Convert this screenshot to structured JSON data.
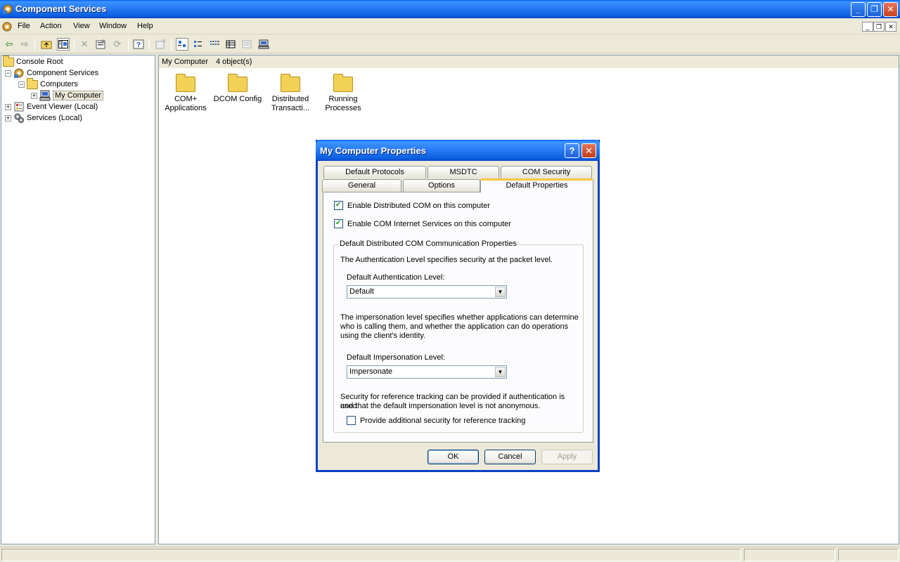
{
  "window": {
    "title": "Component Services",
    "controls": {
      "minimize": "_",
      "maximize": "❐",
      "close": "✕"
    }
  },
  "menubar": {
    "items": [
      "File",
      "Action",
      "View",
      "Window",
      "Help"
    ]
  },
  "toolbar": {
    "icons": [
      "back-icon",
      "forward-icon",
      "up-folder-icon",
      "show-hide-tree-icon",
      "delete-icon",
      "properties-icon",
      "refresh-icon",
      "help-icon",
      "export-icon",
      "large-icons-view-icon",
      "small-icons-view-icon",
      "list-view-icon",
      "detail-view-icon",
      "status-view-icon",
      "configure-computer-icon"
    ]
  },
  "tree": {
    "items": [
      {
        "label": "Console Root",
        "icon": "folder-icon"
      },
      {
        "label": "Component Services",
        "icon": "component-services-icon",
        "expander": "−"
      },
      {
        "label": "Computers",
        "icon": "folder-icon",
        "expander": "−"
      },
      {
        "label": "My Computer",
        "icon": "computer-icon",
        "expander": "+"
      },
      {
        "label": "Event Viewer (Local)",
        "icon": "event-viewer-icon",
        "expander": "+"
      },
      {
        "label": "Services (Local)",
        "icon": "services-icon",
        "expander": "+"
      }
    ]
  },
  "content": {
    "path": "My Computer",
    "count": "4 object(s)",
    "items": [
      {
        "line1": "COM+",
        "line2": "Applications"
      },
      {
        "line1": "DCOM Config",
        "line2": ""
      },
      {
        "line1": "Distributed",
        "line2": "Transacti..."
      },
      {
        "line1": "Running",
        "line2": "Processes"
      }
    ]
  },
  "dialog": {
    "title": "My Computer Properties",
    "help_glyph": "?",
    "close_glyph": "✕",
    "tabs_back": [
      "Default Protocols",
      "MSDTC",
      "COM Security"
    ],
    "tabs_front": [
      "General",
      "Options",
      "Default Properties"
    ],
    "active_tab": "Default Properties",
    "enable_dcom": {
      "label": "Enable Distributed COM on this computer",
      "checked": true
    },
    "enable_cis": {
      "label": "Enable COM Internet Services on this computer",
      "checked": true
    },
    "group": {
      "legend": "Default Distributed COM Communication Properties",
      "auth_desc": "The Authentication Level specifies security at the packet level.",
      "auth_label": "Default Authentication Level:",
      "auth_value": "Default",
      "imp_desc_1": "The impersonation level specifies whether applications can determine",
      "imp_desc_2": "who is calling them, and whether the application can do operations",
      "imp_desc_3": "using the client's identity.",
      "imp_label": "Default Impersonation Level:",
      "imp_value": "Impersonate",
      "ref_desc_1": "Security for reference tracking can be provided if authentication is used",
      "ref_desc_2": "and that the default impersonation level is not anonymous.",
      "ref_checkbox": {
        "label": "Provide additional security for reference tracking",
        "checked": false
      }
    },
    "buttons": {
      "ok": "OK",
      "cancel": "Cancel",
      "apply": "Apply"
    }
  }
}
